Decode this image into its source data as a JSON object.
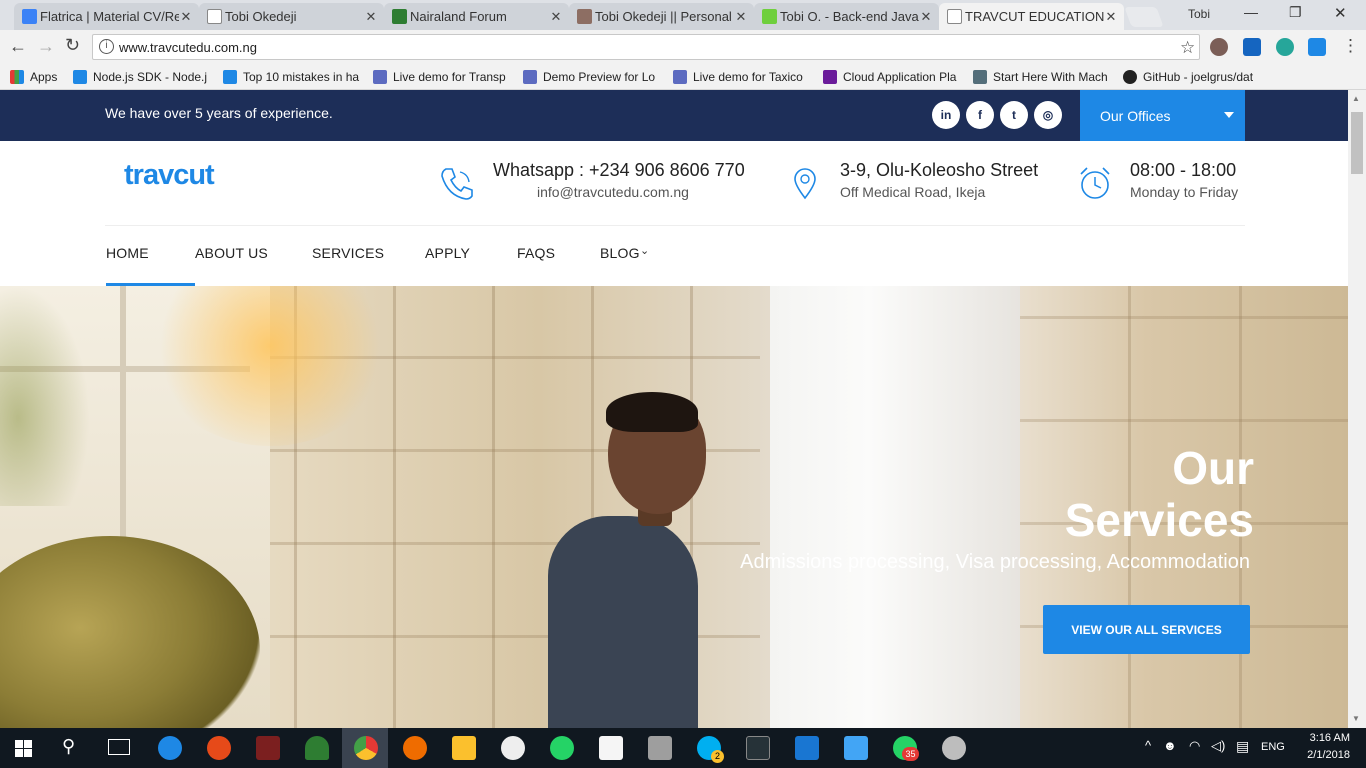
{
  "browser": {
    "tabs": [
      {
        "title": "Flatrica | Material CV/Re",
        "color": "#3b82f6"
      },
      {
        "title": "Tobi Okedeji",
        "color": "#cfd3d9"
      },
      {
        "title": "Nairaland Forum",
        "color": "#2e7d32"
      },
      {
        "title": "Tobi Okedeji || Personal",
        "color": "#8d6e63"
      },
      {
        "title": "Tobi O. - Back-end Java",
        "color": "#6fcf3d"
      },
      {
        "title": "TRAVCUT EDUCATIONA",
        "color": "#f2f2f2"
      }
    ],
    "profile_name": "Tobi",
    "url": "www.travcutedu.com.ng",
    "bookmarks": [
      {
        "label": "Apps",
        "color": "#e53935"
      },
      {
        "label": "Node.js SDK - Node.j",
        "color": "#1e88e5"
      },
      {
        "label": "Top 10 mistakes in ha",
        "color": "#1e88e5"
      },
      {
        "label": "Live demo for Transp",
        "color": "#5c6bc0"
      },
      {
        "label": "Demo Preview for Lo",
        "color": "#5c6bc0"
      },
      {
        "label": "Live demo for Taxico",
        "color": "#5c6bc0"
      },
      {
        "label": "Cloud Application Pla",
        "color": "#6a1b9a"
      },
      {
        "label": "Start Here With Mach",
        "color": "#546e7a"
      },
      {
        "label": "GitHub - joelgrus/dat",
        "color": "#222222"
      }
    ]
  },
  "site": {
    "topbar_text": "We have over 5 years of experience.",
    "social": [
      {
        "label": "in",
        "name": "linkedin-icon"
      },
      {
        "label": "f",
        "name": "facebook-icon"
      },
      {
        "label": "t",
        "name": "twitter-icon"
      },
      {
        "label": "◎",
        "name": "instagram-icon"
      }
    ],
    "offices_label": "Our Offices",
    "logo_text": "travcut",
    "contact": {
      "phone_title": "Whatsapp : +234 906 8606 770",
      "phone_sub": "info@travcutedu.com.ng",
      "address_title": "3-9, Olu-Koleosho Street",
      "address_sub": "Off Medical Road, Ikeja",
      "hours_title": "08:00 - 18:00",
      "hours_sub": "Monday to Friday"
    },
    "nav": [
      "HOME",
      "ABOUT US",
      "SERVICES",
      "APPLY",
      "FAQS",
      "BLOG"
    ],
    "hero": {
      "title_line1": "Our",
      "title_line2": "Services",
      "subtitle": "Admissions processing, Visa processing, Accommodation",
      "button": "VIEW OUR ALL SERVICES"
    },
    "accent_color": "#1e88e5",
    "topbar_color": "#1d2e58"
  },
  "taskbar": {
    "language": "ENG",
    "time": "3:16 AM",
    "date": "2/1/2018",
    "badges": [
      "2",
      "35"
    ]
  }
}
